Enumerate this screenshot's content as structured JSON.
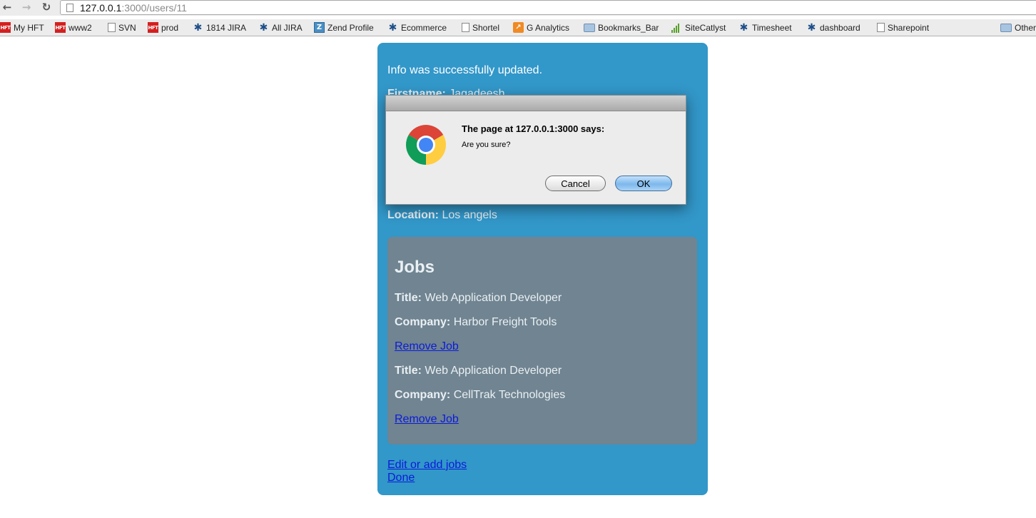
{
  "browser": {
    "url_host": "127.0.0.1",
    "url_rest": ":3000/users/11",
    "bookmarks": [
      {
        "label": "My HFT",
        "icon": "hft-icon"
      },
      {
        "label": "www2",
        "icon": "hft-icon"
      },
      {
        "label": "SVN",
        "icon": "page-icon"
      },
      {
        "label": "prod",
        "icon": "hft-icon"
      },
      {
        "label": "1814 JIRA",
        "icon": "jira-icon"
      },
      {
        "label": "All JIRA",
        "icon": "jira-icon"
      },
      {
        "label": "Zend Profile",
        "icon": "zend-icon"
      },
      {
        "label": "Ecommerce",
        "icon": "jira-icon"
      },
      {
        "label": "Shortel",
        "icon": "page-icon"
      },
      {
        "label": "G Analytics",
        "icon": "analytics-icon"
      },
      {
        "label": "Bookmarks_Bar",
        "icon": "folder-icon"
      },
      {
        "label": "SiteCatlyst",
        "icon": "bars-icon"
      },
      {
        "label": "Timesheet",
        "icon": "jira-icon"
      },
      {
        "label": "dashboard",
        "icon": "jira-icon"
      },
      {
        "label": "Sharepoint",
        "icon": "page-icon"
      },
      {
        "label": "Other",
        "icon": "folder-icon"
      }
    ]
  },
  "page": {
    "notice": "Info was successfully updated.",
    "firstname_label": "Firstname:",
    "firstname_value": "Jagadeesh",
    "location_label": "Location:",
    "location_value": "Los angels",
    "jobs_heading": "Jobs",
    "jobs": [
      {
        "title_label": "Title:",
        "title": "Web Application Developer",
        "company_label": "Company:",
        "company": "Harbor Freight Tools",
        "remove_label": "Remove Job"
      },
      {
        "title_label": "Title:",
        "title": "Web Application Developer",
        "company_label": "Company:",
        "company": "CellTrak Technologies",
        "remove_label": "Remove Job"
      }
    ],
    "edit_jobs_link": "Edit or add jobs",
    "done_link": "Done"
  },
  "dialog": {
    "title": "The page at 127.0.0.1:3000 says:",
    "message": "Are you sure?",
    "cancel_label": "Cancel",
    "ok_label": "OK",
    "icon": "chrome-logo-icon"
  },
  "colors": {
    "card": "#3297c9",
    "jobs_panel": "#708491",
    "link": "#0b1cd9",
    "dialog_bg": "#ececec"
  }
}
